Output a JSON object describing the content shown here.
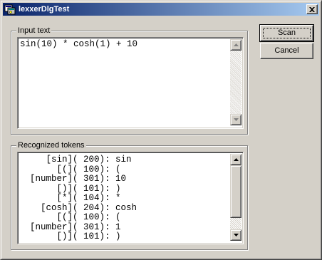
{
  "window": {
    "title": "lexxerDlgTest"
  },
  "input_group": {
    "label": "Input text",
    "text": "sin(10) * cosh(1) + 10"
  },
  "tokens_group": {
    "label": "Recognized tokens",
    "lines": [
      "     [sin]( 200): sin",
      "       [(]( 100): (",
      "  [number]( 301): 10",
      "       [)]( 101): )",
      "       [*]( 104): *",
      "    [cosh]( 204): cosh",
      "       [(]( 100): (",
      "  [number]( 301): 1",
      "       [)]( 101): )"
    ]
  },
  "buttons": {
    "scan": "Scan",
    "cancel": "Cancel"
  },
  "icons": {
    "close": "close-icon",
    "app": "app-icon"
  }
}
